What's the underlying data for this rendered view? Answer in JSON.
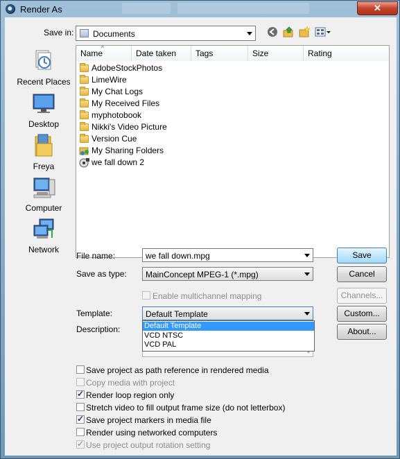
{
  "window": {
    "title": "Render As",
    "close_glyph": "✕"
  },
  "toolbar": {
    "save_in_label": "Save in:",
    "save_in_value": "Documents",
    "icons": [
      "back-icon",
      "up-folder-icon",
      "new-folder-icon",
      "view-menu-icon"
    ]
  },
  "places": [
    {
      "label": "Recent Places",
      "icon": "recent-places-icon"
    },
    {
      "label": "Desktop",
      "icon": "desktop-icon"
    },
    {
      "label": "Freya",
      "icon": "user-folder-icon"
    },
    {
      "label": "Computer",
      "icon": "computer-icon"
    },
    {
      "label": "Network",
      "icon": "network-icon"
    }
  ],
  "file_list": {
    "columns": [
      "Name",
      "Date taken",
      "Tags",
      "Size",
      "Rating"
    ],
    "items": [
      {
        "name": "AdobeStockPhotos",
        "type": "folder"
      },
      {
        "name": "LimeWire",
        "type": "folder"
      },
      {
        "name": "My Chat Logs",
        "type": "folder"
      },
      {
        "name": "My Received Files",
        "type": "folder"
      },
      {
        "name": "myphotobook",
        "type": "folder"
      },
      {
        "name": "Nikki's Video Picture",
        "type": "folder"
      },
      {
        "name": "Version Cue",
        "type": "folder"
      },
      {
        "name": "My Sharing Folders",
        "type": "shared-folder"
      },
      {
        "name": "we fall down 2",
        "type": "project-file"
      }
    ]
  },
  "form": {
    "file_name_label": "File name:",
    "file_name_value": "we fall down.mpg",
    "save_as_type_label": "Save as type:",
    "save_as_type_value": "MainConcept MPEG-1 (*.mpg)",
    "multichannel_label": "Enable multichannel mapping",
    "template_label": "Template:",
    "template_value": "Default Template",
    "description_label": "Description:",
    "template_options": [
      "Default Template",
      "VCD NTSC",
      "VCD PAL"
    ]
  },
  "buttons": {
    "save": "Save",
    "cancel": "Cancel",
    "channels": "Channels...",
    "custom": "Custom...",
    "about": "About..."
  },
  "options": [
    {
      "label": "Save project as path reference in rendered media",
      "checked": false,
      "disabled": false
    },
    {
      "label": "Copy media with project",
      "checked": false,
      "disabled": true
    },
    {
      "label": "Render loop region only",
      "checked": true,
      "disabled": false
    },
    {
      "label": "Stretch video to fill output frame size (do not letterbox)",
      "checked": false,
      "disabled": false
    },
    {
      "label": "Save project markers in media file",
      "checked": true,
      "disabled": false
    },
    {
      "label": "Render using networked computers",
      "checked": false,
      "disabled": false
    },
    {
      "label": "Use project output rotation setting",
      "checked": true,
      "disabled": true
    }
  ]
}
